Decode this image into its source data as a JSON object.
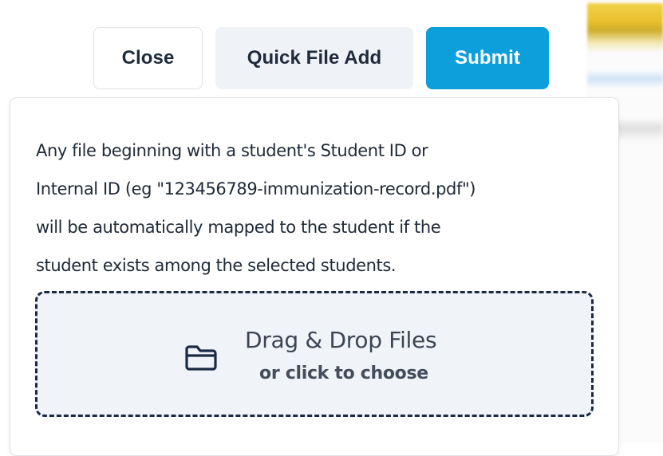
{
  "toolbar": {
    "close_label": "Close",
    "quick_file_add_label": "Quick File Add",
    "submit_label": "Submit"
  },
  "popover": {
    "help_lines": [
      "Any file beginning with a student's Student ID or",
      "Internal ID (eg \"123456789-immunization-record.pdf\")",
      "will be automatically mapped to the student if the",
      "student exists among the selected students."
    ],
    "dropzone": {
      "icon": "folder-icon",
      "title": "Drag & Drop Files",
      "subtitle": "or click to choose"
    }
  },
  "colors": {
    "submit_bg": "#0c9fdc",
    "quick_add_bg": "#eff2f6",
    "dropzone_bg": "#f0f3f7",
    "dropzone_border": "#1b2a44",
    "text_dark": "#1f2a3a"
  }
}
